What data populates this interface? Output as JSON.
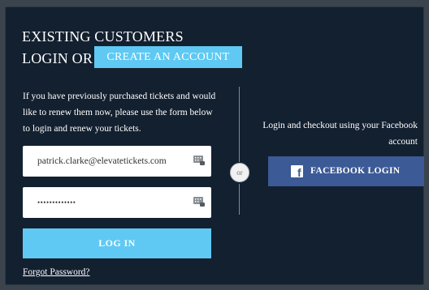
{
  "login": {
    "heading_line1": "EXISTING CUSTOMERS",
    "heading_line2": "LOGIN OR",
    "create_account_label": "CREATE AN ACCOUNT",
    "intro_text": "If you have previously purchased tickets and would like to renew them now, please use the form below to login and renew your tickets.",
    "email_value": "patrick.clarke@elevatetickets.com",
    "password_value": "•••••••••••••",
    "login_button_label": "LOG IN",
    "forgot_password_label": "Forgot Password?"
  },
  "divider": {
    "or_label": "or"
  },
  "facebook": {
    "prompt_text": "Login and checkout using your Facebook account",
    "button_label": "FACEBOOK LOGIN",
    "icon_glyph": "f"
  },
  "icons": {
    "field_icon": "keypass-icon",
    "facebook_icon": "facebook-icon"
  },
  "colors": {
    "panel_background": "#132030",
    "accent_blue": "#5fc9f3",
    "facebook_blue": "#3b5a96"
  }
}
